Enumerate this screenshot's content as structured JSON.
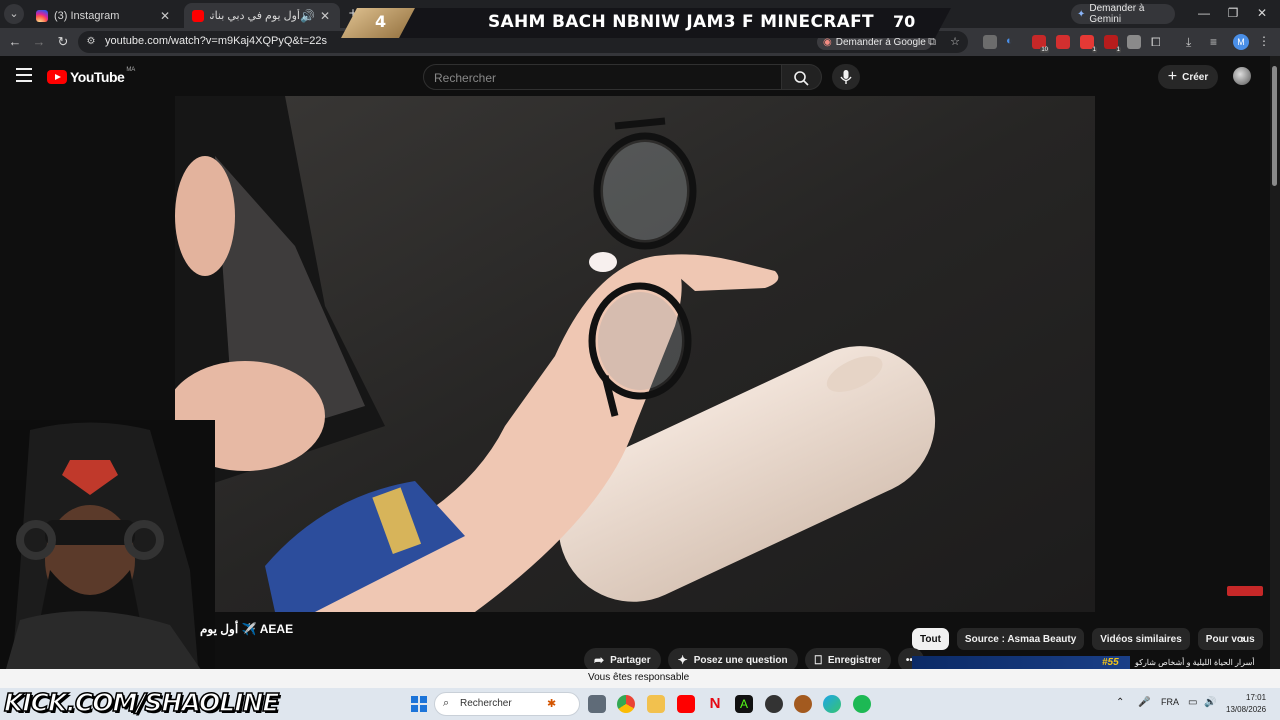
{
  "browser": {
    "tabs": [
      {
        "title": "(3) Instagram",
        "favicon_color": "#d62976",
        "active": false
      },
      {
        "title": "أول يوم في دبي بناتي فرحو",
        "favicon_color": "#ff0000",
        "active": true
      }
    ],
    "ask_gemini": "Demander à Gemini",
    "url": "youtube.com/watch?v=m9Kaj4XQPyQ&t=22s",
    "ask_google": "Demander à Google",
    "profile_initial": "M"
  },
  "stream_overlay": {
    "number": "4",
    "title": "SAHM BACH NBNIW JAM3 F MINECRAFT",
    "count": "70"
  },
  "youtube": {
    "logo_text": "YouTube",
    "country_code": "MA",
    "search_placeholder": "Rechercher",
    "create_label": "Créer",
    "video_title": "أول يوم ✈️ AEAE",
    "chips": [
      "Tout",
      "Source : Asmaa Beauty",
      "Vidéos similaires",
      "Pour vous"
    ],
    "actions": {
      "share": "Partager",
      "ask": "Posez une question",
      "save": "Enregistrer"
    },
    "next_video_title": "أسرار الحياة الليلية و أشخاص شاركو",
    "next_video_tag": "#55"
  },
  "responsible_notice": "Vous êtes responsable",
  "kick": {
    "prefix": "K",
    "rest": "KICK.COM/SHAOLINE"
  },
  "taskbar": {
    "search_placeholder": "Rechercher",
    "language": "FRA",
    "time": "17:01",
    "date": "13/08/2026"
  },
  "colors": {
    "yt_red": "#ff0000",
    "kick_green": "#53fc18",
    "overlay_gold": "#c9a46c"
  }
}
